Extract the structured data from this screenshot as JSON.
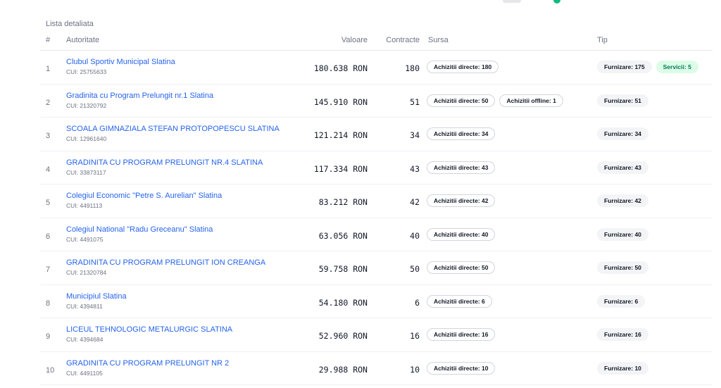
{
  "section_title": "Lista detaliata",
  "columns": {
    "num": "#",
    "authority": "Autoritate",
    "value": "Valoare",
    "contracts": "Contracte",
    "source": "Sursa",
    "type": "Tip"
  },
  "colors": {
    "link": "#2563eb",
    "green_badge_bg": "#dcfce7",
    "green_badge_text": "#047857",
    "accent": "#10b981"
  },
  "rows": [
    {
      "idx": "1",
      "name": "Clubul Sportiv Municipal Slatina",
      "cui": "CUI: 25755633",
      "value": "180.638 RON",
      "contracts": "180",
      "sources": [
        "Achizitii directe: 180"
      ],
      "types": [
        {
          "label": "Furnizare: 175",
          "style": "gray"
        },
        {
          "label": "Servicii: 5",
          "style": "green"
        }
      ]
    },
    {
      "idx": "2",
      "name": "Gradinita cu Program Prelungit nr.1 Slatina",
      "cui": "CUI: 21320792",
      "value": "145.910 RON",
      "contracts": "51",
      "sources": [
        "Achizitii directe: 50",
        "Achizitii offline: 1"
      ],
      "types": [
        {
          "label": "Furnizare: 51",
          "style": "gray"
        }
      ]
    },
    {
      "idx": "3",
      "name": "SCOALA GIMNAZIALA STEFAN PROTOPOPESCU SLATINA",
      "cui": "CUI: 12961640",
      "value": "121.214 RON",
      "contracts": "34",
      "sources": [
        "Achizitii directe: 34"
      ],
      "types": [
        {
          "label": "Furnizare: 34",
          "style": "gray"
        }
      ]
    },
    {
      "idx": "4",
      "name": "GRADINITA CU PROGRAM PRELUNGIT NR.4 SLATINA",
      "cui": "CUI: 33873117",
      "value": "117.334 RON",
      "contracts": "43",
      "sources": [
        "Achizitii directe: 43"
      ],
      "types": [
        {
          "label": "Furnizare: 43",
          "style": "gray"
        }
      ]
    },
    {
      "idx": "5",
      "name": "Colegiul Economic \"Petre S. Aurelian\" Slatina",
      "cui": "CUI: 4491113",
      "value": "83.212 RON",
      "contracts": "42",
      "sources": [
        "Achizitii directe: 42"
      ],
      "types": [
        {
          "label": "Furnizare: 42",
          "style": "gray"
        }
      ]
    },
    {
      "idx": "6",
      "name": "Colegiul National \"Radu Greceanu\" Slatina",
      "cui": "CUI: 4491075",
      "value": "63.056 RON",
      "contracts": "40",
      "sources": [
        "Achizitii directe: 40"
      ],
      "types": [
        {
          "label": "Furnizare: 40",
          "style": "gray"
        }
      ]
    },
    {
      "idx": "7",
      "name": "GRADINITA CU PROGRAM PRELUNGIT ION CREANGA",
      "cui": "CUI: 21320784",
      "value": "59.758 RON",
      "contracts": "50",
      "sources": [
        "Achizitii directe: 50"
      ],
      "types": [
        {
          "label": "Furnizare: 50",
          "style": "gray"
        }
      ]
    },
    {
      "idx": "8",
      "name": "Municipiul Slatina",
      "cui": "CUI: 4394811",
      "value": "54.180 RON",
      "contracts": "6",
      "sources": [
        "Achizitii directe: 6"
      ],
      "types": [
        {
          "label": "Furnizare: 6",
          "style": "gray"
        }
      ]
    },
    {
      "idx": "9",
      "name": "LICEUL TEHNOLOGIC METALURGIC SLATINA",
      "cui": "CUI: 4394684",
      "value": "52.960 RON",
      "contracts": "16",
      "sources": [
        "Achizitii directe: 16"
      ],
      "types": [
        {
          "label": "Furnizare: 16",
          "style": "gray"
        }
      ]
    },
    {
      "idx": "10",
      "name": "GRADINITA CU PROGRAM PRELUNGIT NR 2",
      "cui": "CUI: 4491105",
      "value": "29.988 RON",
      "contracts": "10",
      "sources": [
        "Achizitii directe: 10"
      ],
      "types": [
        {
          "label": "Furnizare: 10",
          "style": "gray"
        }
      ]
    }
  ]
}
